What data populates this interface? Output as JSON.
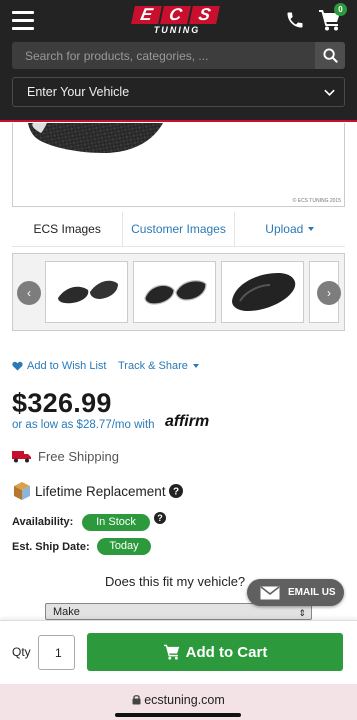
{
  "header": {
    "logo_top": [
      "E",
      "C",
      "S"
    ],
    "logo_bottom": "TUNING",
    "cart_count": "0",
    "search_placeholder": "Search for products, categories, ...",
    "vehicle_label": "Enter Your Vehicle",
    "icons": [
      "hamburger-icon",
      "phone-icon",
      "cart-icon",
      "search-icon",
      "chevron-down-icon"
    ]
  },
  "main_image": {
    "watermark": "© ECS TUNING 2015"
  },
  "image_tabs": {
    "ecs": "ECS Images",
    "customer": "Customer Images",
    "upload": "Upload"
  },
  "carousel": {
    "prev": "‹",
    "next": "›"
  },
  "product": {
    "wishlist": "Add to Wish List",
    "track_share": "Track & Share",
    "price": "$326.99",
    "affirm_text": "or as low as $28.77/mo with",
    "affirm_brand": "affirm",
    "shipping": "Free Shipping",
    "lifetime": "Lifetime Replacement",
    "availability_label": "Availability:",
    "availability_value": "In Stock",
    "ship_date_label": "Est. Ship Date:",
    "ship_date_value": "Today",
    "fit_question": "Does this fit my vehicle?",
    "make_select": "Make",
    "email_us": "EMAIL US"
  },
  "cart_bar": {
    "qty_label": "Qty",
    "qty_value": "1",
    "add_to_cart": "Add to Cart"
  },
  "browser": {
    "url": "ecstuning.com"
  },
  "colors": {
    "header_bg": "#232323",
    "brand_red": "#c8102e",
    "accent_green": "#2c9a3c",
    "link_blue": "#2a7ab8"
  }
}
